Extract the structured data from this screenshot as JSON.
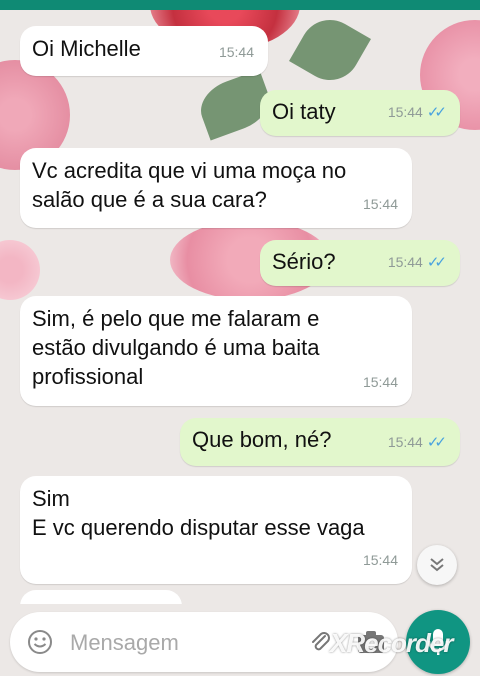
{
  "chat": {
    "messages": [
      {
        "direction": "in",
        "text": "Oi Michelle",
        "time": "15:44"
      },
      {
        "direction": "out",
        "text": "Oi taty",
        "time": "15:44",
        "status": "read"
      },
      {
        "direction": "in",
        "text": "Vc acredita que vi uma moça no\nsalão que é a sua cara?",
        "time": "15:44"
      },
      {
        "direction": "out",
        "text": "Sério?",
        "time": "15:44",
        "status": "read"
      },
      {
        "direction": "in",
        "text": "Sim, é pelo que me falaram e\nestão divulgando é uma baita\nprofissional",
        "time": "15:44"
      },
      {
        "direction": "out",
        "text": "Que bom, né?",
        "time": "15:44",
        "status": "read"
      },
      {
        "direction": "in",
        "text": "Sim\nE vc querendo disputar esse vaga",
        "time": "15:44"
      }
    ],
    "read_tick_icon": "double-check-icon",
    "read_tick_color": "#4aa3df"
  },
  "input_bar": {
    "placeholder": "Mensagem",
    "icons": [
      "emoji-icon",
      "paperclip-icon",
      "camera-icon"
    ]
  },
  "mic_button": {
    "icon": "microphone-icon",
    "color": "#109582"
  },
  "scroll_down_button": {
    "icon": "chevron-double-down-icon"
  },
  "watermark": {
    "text": "XRecorder"
  },
  "colors": {
    "incoming_bubble": "#ffffff",
    "outgoing_bubble": "#e2f7cc",
    "accent": "#0f8a74"
  }
}
